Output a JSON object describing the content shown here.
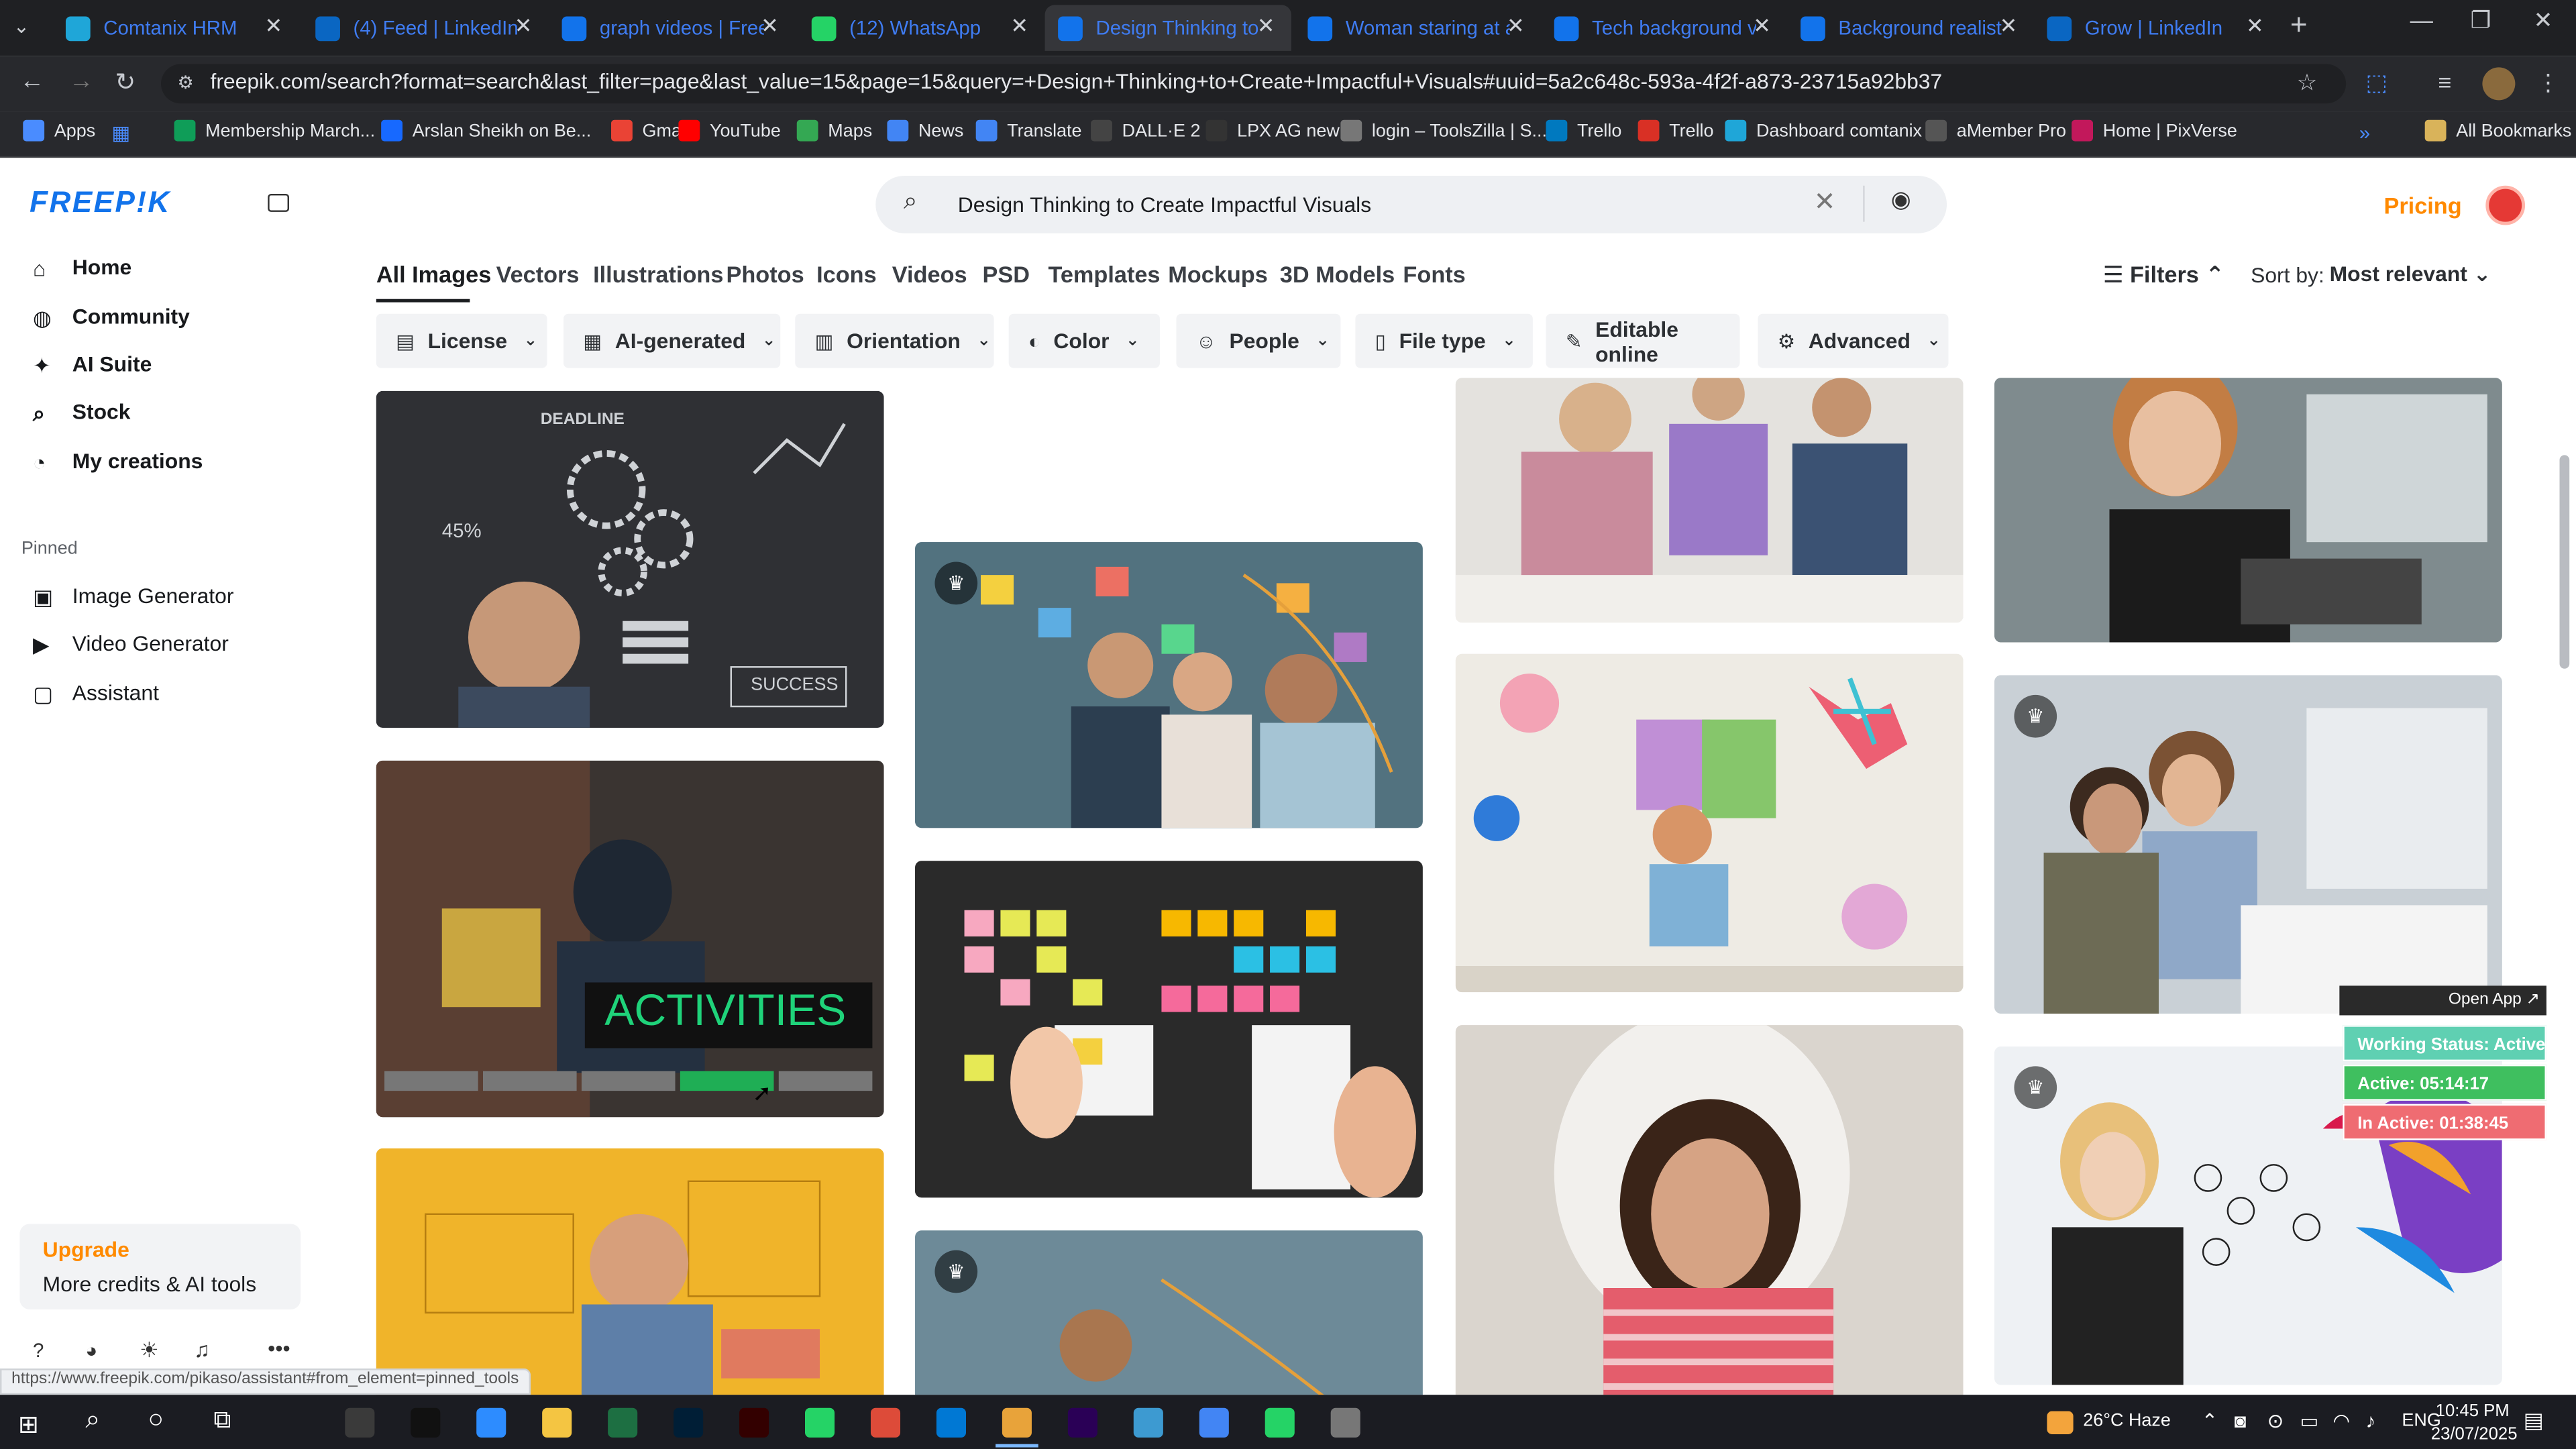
{
  "tabs": [
    {
      "title": "Comtanix HRM",
      "icon": "comtanix-icon",
      "color": "#1fa6d8"
    },
    {
      "title": "(4) Feed | LinkedIn",
      "icon": "linkedin-icon",
      "color": "#0a66c2"
    },
    {
      "title": "graph videos | Freepik",
      "icon": "freepik-icon",
      "color": "#1273eb"
    },
    {
      "title": "(12) WhatsApp",
      "icon": "whatsapp-icon",
      "color": "#25d366"
    },
    {
      "title": "Design Thinking to C",
      "icon": "freepik-icon",
      "color": "#1273eb"
    },
    {
      "title": "Woman staring at a",
      "icon": "freepik-icon",
      "color": "#1273eb"
    },
    {
      "title": "Tech background vec",
      "icon": "freepik-icon",
      "color": "#1273eb"
    },
    {
      "title": "Background realistic",
      "icon": "freepik-icon",
      "color": "#1273eb"
    },
    {
      "title": "Grow | LinkedIn",
      "icon": "linkedin-icon",
      "color": "#0a66c2"
    }
  ],
  "address": {
    "url": "freepik.com/search?format=search&last_filter=page&last_value=15&page=15&query=+Design+Thinking+to+Create+Impactful+Visuals#uuid=5a2c648c-593a-4f2f-a873-23715a92bb37"
  },
  "bookmarks": {
    "apps": "Apps",
    "items": [
      {
        "label": "Membership March...",
        "color": "#0f9d58"
      },
      {
        "label": "Arslan Sheikh on Be...",
        "color": "#1769ff"
      },
      {
        "label": "Gmail",
        "color": "#ea4335"
      },
      {
        "label": "YouTube",
        "color": "#ff0000"
      },
      {
        "label": "Maps",
        "color": "#34a853"
      },
      {
        "label": "News",
        "color": "#4285f4"
      },
      {
        "label": "Translate",
        "color": "#4285f4"
      },
      {
        "label": "DALL·E 2",
        "color": "#444444"
      },
      {
        "label": "LPX AG new",
        "color": "#333333"
      },
      {
        "label": "login – ToolsZilla | S...",
        "color": "#777777"
      },
      {
        "label": "Trello",
        "color": "#0079bf"
      },
      {
        "label": "Trello",
        "color": "#d93025"
      },
      {
        "label": "Dashboard comtanix",
        "color": "#1fa6d8"
      },
      {
        "label": "aMember Pro",
        "color": "#555555"
      },
      {
        "label": "Home | PixVerse",
        "color": "#c2185b"
      }
    ],
    "all": "All Bookmarks"
  },
  "freepik": {
    "logo": "FREEP!K",
    "search": "Design Thinking to Create Impactful Visuals",
    "pricing": "Pricing",
    "sidebar": [
      {
        "label": "Home",
        "icon": "home-icon"
      },
      {
        "label": "Community",
        "icon": "globe-icon"
      },
      {
        "label": "AI Suite",
        "icon": "sparkle-icon"
      },
      {
        "label": "Stock",
        "icon": "search-icon"
      },
      {
        "label": "My creations",
        "icon": "person-icon"
      }
    ],
    "pinned_title": "Pinned",
    "pinned": [
      {
        "label": "Image Generator",
        "icon": "image-icon"
      },
      {
        "label": "Video Generator",
        "icon": "video-icon"
      },
      {
        "label": "Assistant",
        "icon": "chat-icon"
      }
    ],
    "upgrade": {
      "title": "Upgrade",
      "text": "More credits & AI tools"
    },
    "categories": [
      "All Images",
      "Vectors",
      "Illustrations",
      "Photos",
      "Icons",
      "Videos",
      "PSD",
      "Templates",
      "Mockups",
      "3D Models",
      "Fonts"
    ],
    "filters_btn": "Filters",
    "sort_label": "Sort by:",
    "sort_value": "Most relevant",
    "filters": [
      {
        "label": "License",
        "icon": "license-icon"
      },
      {
        "label": "AI-generated",
        "icon": "ai-icon"
      },
      {
        "label": "Orientation",
        "icon": "orientation-icon"
      },
      {
        "label": "Color",
        "icon": "color-icon"
      },
      {
        "label": "People",
        "icon": "people-icon"
      },
      {
        "label": "File type",
        "icon": "file-icon"
      },
      {
        "label": "Editable online",
        "icon": "edit-icon"
      },
      {
        "label": "Advanced",
        "icon": "gear-icon"
      }
    ],
    "thumb_text": {
      "activities": "ACTIVITIES",
      "success": "SUCCESS",
      "deadline": "DEADLINE",
      "pct": "45%"
    }
  },
  "widget": {
    "open": "Open App ↗",
    "status": "Working Status: Active",
    "active": "Active: 05:14:17",
    "inactive": "In Active: 01:38:45"
  },
  "status_url": "https://www.freepik.com/pikaso/assistant#from_element=pinned_tools",
  "tray": {
    "weather": "26°C Haze",
    "lang": "ENG",
    "time": "10:45 PM",
    "date": "23/07/2025"
  },
  "colors": {
    "brand": "#1273eb",
    "accent": "#ff6b35",
    "pricing": "#ff8a00"
  }
}
